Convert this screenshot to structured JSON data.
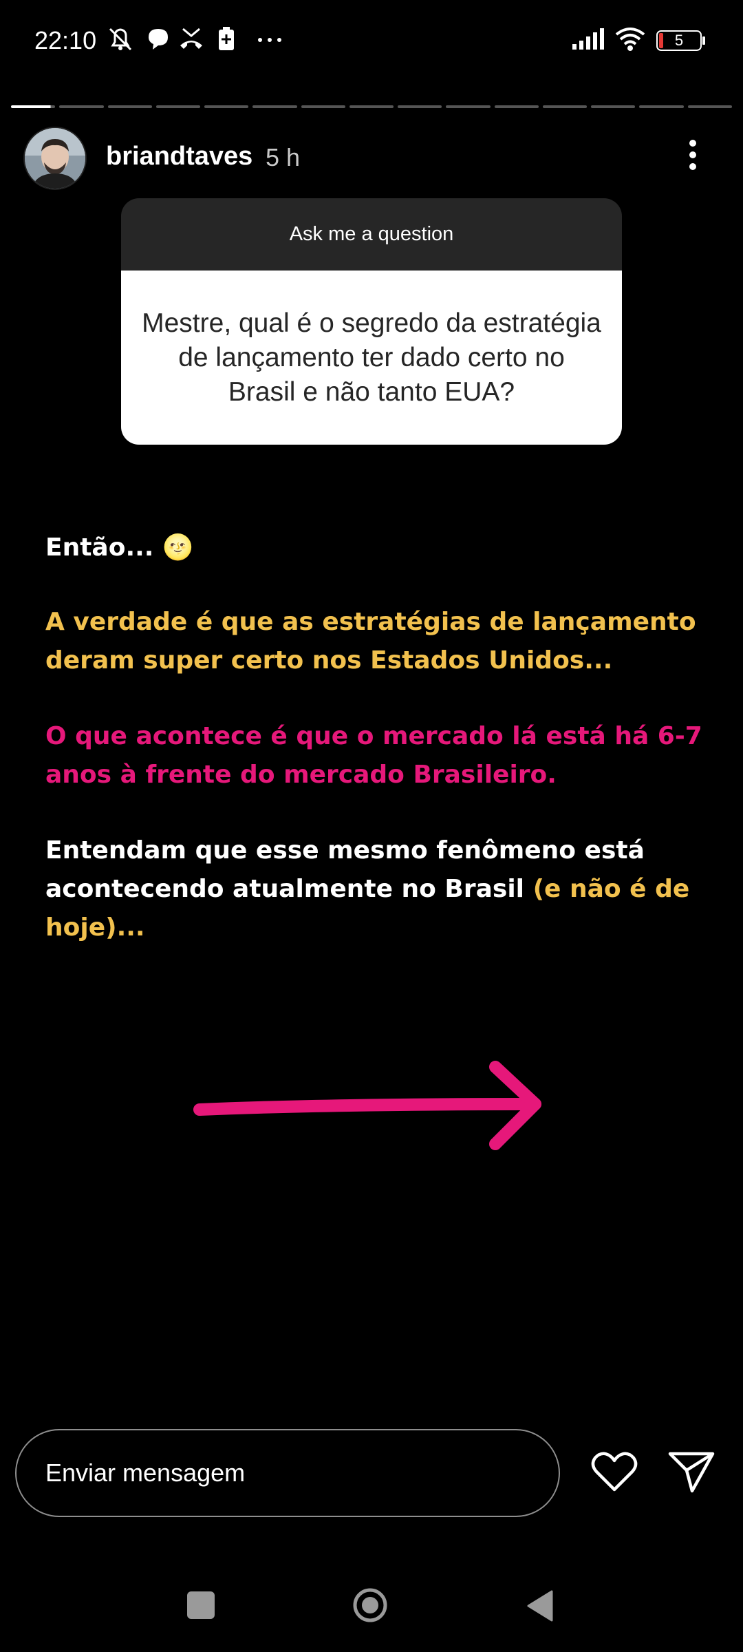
{
  "status_bar": {
    "time": "22:10",
    "icons_left": [
      "mute-bell-icon",
      "chat-bubble-icon",
      "missed-call-icon",
      "battery-saver-icon",
      "more-dots-icon"
    ],
    "icons_right": [
      "signal-icon",
      "wifi-icon",
      "battery-icon"
    ],
    "battery_level": "5"
  },
  "story": {
    "segments_total": 15,
    "current_segment": 1,
    "progress": 0.1,
    "username": "briandtaves",
    "time_ago": "5 h"
  },
  "question_card": {
    "header": "Ask me a question",
    "question": "Mestre, qual é o segredo da estratégia de lançamento ter dado certo no Brasil e não tanto EUA?"
  },
  "story_text": {
    "line1": "Então... 🌝",
    "paragraph_yellow": "A verdade é que as estratégias de lançamento deram super certo nos Estados Unidos...",
    "paragraph_pink": "O que acontece é que o mercado lá está há 6-7 anos à frente do mercado Brasileiro.",
    "paragraph_white": "Entendam que esse mesmo fenômeno está acontecendo atualmente no Brasil",
    "paragraph_white_highlight": "(e não é de hoje)..."
  },
  "colors": {
    "yellow": "#f2c14e",
    "pink": "#e6187a",
    "bg": "#000000"
  },
  "message_bar": {
    "placeholder": "Enviar mensagem"
  }
}
